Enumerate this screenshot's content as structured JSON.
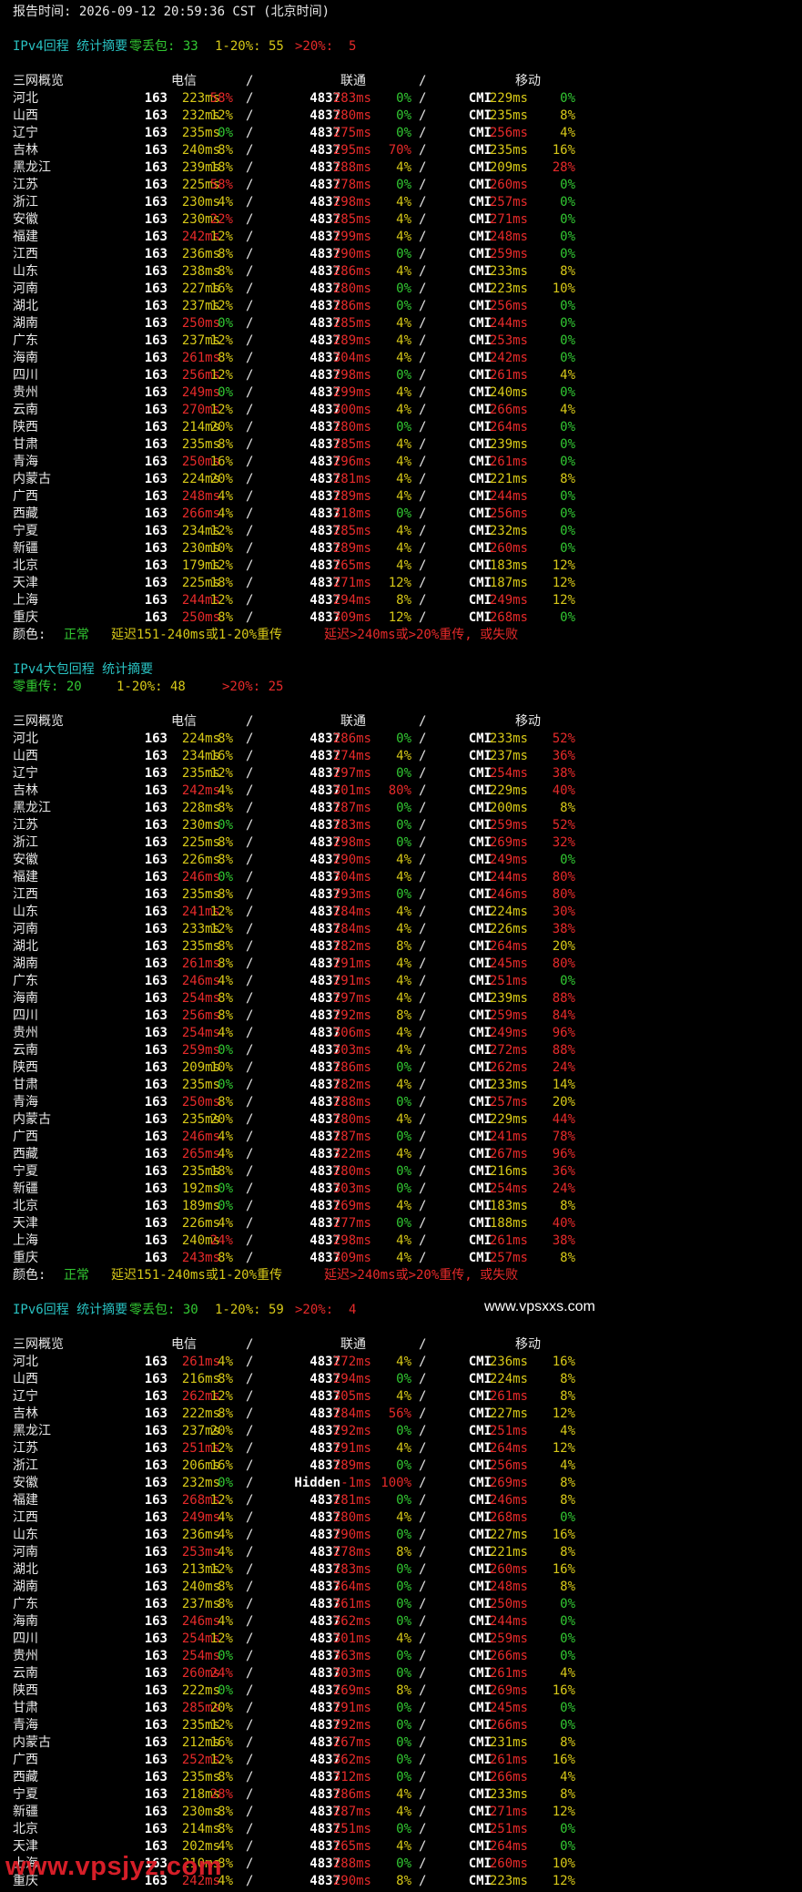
{
  "colors": {
    "normal": "#32c832",
    "mid": "#d7c818",
    "bad": "#e62a2a",
    "title": "#29c2c2"
  },
  "report_time": "报告时间: 2026-09-12 20:59:36 CST (北京时间)",
  "header": {
    "region": "三网概览",
    "telecom": "电信",
    "unicom": "联通",
    "mobile": "移动",
    "slash": "/"
  },
  "legend": {
    "label": "颜色: ",
    "normal": "正常",
    "mid": "延迟151-240ms或1-20%重传",
    "bad": "延迟>240ms或>20%重传, 或失败"
  },
  "watermark_mid": "www.vpsxxs.com",
  "watermark_bottom": "www.vpsjyz.com",
  "sections": [
    {
      "title": "IPv4回程 统计摘要",
      "summary": [
        {
          "text": "零丢包: 33",
          "c": "g"
        },
        {
          "text": "1-20%: 55",
          "c": "y"
        },
        {
          "text": ">20%:  5",
          "c": "rd"
        }
      ],
      "summary_on_next_line": false,
      "rows": [
        [
          "河北",
          "163",
          "223ms",
          "58%",
          "4837",
          "283ms",
          "0%",
          "CMI",
          "229ms",
          "0%"
        ],
        [
          "山西",
          "163",
          "232ms",
          "12%",
          "4837",
          "280ms",
          "0%",
          "CMI",
          "235ms",
          "8%"
        ],
        [
          "辽宁",
          "163",
          "235ms",
          "0%",
          "4837",
          "275ms",
          "0%",
          "CMI",
          "256ms",
          "4%"
        ],
        [
          "吉林",
          "163",
          "240ms",
          "8%",
          "4837",
          "295ms",
          "70%",
          "CMI",
          "235ms",
          "16%"
        ],
        [
          "黑龙江",
          "163",
          "239ms",
          "18%",
          "4837",
          "288ms",
          "4%",
          "CMI",
          "209ms",
          "28%"
        ],
        [
          "江苏",
          "163",
          "225ms",
          "58%",
          "4837",
          "278ms",
          "0%",
          "CMI",
          "260ms",
          "0%"
        ],
        [
          "浙江",
          "163",
          "230ms",
          "4%",
          "4837",
          "298ms",
          "4%",
          "CMI",
          "257ms",
          "0%"
        ],
        [
          "安徽",
          "163",
          "230ms",
          "22%",
          "4837",
          "285ms",
          "4%",
          "CMI",
          "271ms",
          "0%"
        ],
        [
          "福建",
          "163",
          "242ms",
          "12%",
          "4837",
          "299ms",
          "4%",
          "CMI",
          "248ms",
          "0%"
        ],
        [
          "江西",
          "163",
          "236ms",
          "8%",
          "4837",
          "290ms",
          "0%",
          "CMI",
          "259ms",
          "0%"
        ],
        [
          "山东",
          "163",
          "238ms",
          "8%",
          "4837",
          "286ms",
          "4%",
          "CMI",
          "233ms",
          "8%"
        ],
        [
          "河南",
          "163",
          "227ms",
          "16%",
          "4837",
          "280ms",
          "0%",
          "CMI",
          "223ms",
          "10%"
        ],
        [
          "湖北",
          "163",
          "237ms",
          "12%",
          "4837",
          "286ms",
          "0%",
          "CMI",
          "256ms",
          "0%"
        ],
        [
          "湖南",
          "163",
          "250ms",
          "0%",
          "4837",
          "285ms",
          "4%",
          "CMI",
          "244ms",
          "0%"
        ],
        [
          "广东",
          "163",
          "237ms",
          "12%",
          "4837",
          "289ms",
          "4%",
          "CMI",
          "253ms",
          "0%"
        ],
        [
          "海南",
          "163",
          "261ms",
          "8%",
          "4837",
          "304ms",
          "4%",
          "CMI",
          "242ms",
          "0%"
        ],
        [
          "四川",
          "163",
          "256ms",
          "12%",
          "4837",
          "298ms",
          "0%",
          "CMI",
          "261ms",
          "4%"
        ],
        [
          "贵州",
          "163",
          "249ms",
          "0%",
          "4837",
          "299ms",
          "4%",
          "CMI",
          "240ms",
          "0%"
        ],
        [
          "云南",
          "163",
          "270ms",
          "12%",
          "4837",
          "300ms",
          "4%",
          "CMI",
          "266ms",
          "4%"
        ],
        [
          "陕西",
          "163",
          "214ms",
          "20%",
          "4837",
          "280ms",
          "0%",
          "CMI",
          "264ms",
          "0%"
        ],
        [
          "甘肃",
          "163",
          "235ms",
          "8%",
          "4837",
          "285ms",
          "4%",
          "CMI",
          "239ms",
          "0%"
        ],
        [
          "青海",
          "163",
          "250ms",
          "16%",
          "4837",
          "296ms",
          "4%",
          "CMI",
          "261ms",
          "0%"
        ],
        [
          "内蒙古",
          "163",
          "224ms",
          "20%",
          "4837",
          "281ms",
          "4%",
          "CMI",
          "221ms",
          "8%"
        ],
        [
          "广西",
          "163",
          "248ms",
          "4%",
          "4837",
          "289ms",
          "4%",
          "CMI",
          "244ms",
          "0%"
        ],
        [
          "西藏",
          "163",
          "266ms",
          "4%",
          "4837",
          "318ms",
          "0%",
          "CMI",
          "256ms",
          "0%"
        ],
        [
          "宁夏",
          "163",
          "234ms",
          "12%",
          "4837",
          "285ms",
          "4%",
          "CMI",
          "232ms",
          "0%"
        ],
        [
          "新疆",
          "163",
          "230ms",
          "10%",
          "4837",
          "289ms",
          "4%",
          "CMI",
          "260ms",
          "0%"
        ],
        [
          "北京",
          "163",
          "179ms",
          "12%",
          "4837",
          "265ms",
          "4%",
          "CMI",
          "183ms",
          "12%"
        ],
        [
          "天津",
          "163",
          "225ms",
          "18%",
          "4837",
          "271ms",
          "12%",
          "CMI",
          "187ms",
          "12%"
        ],
        [
          "上海",
          "163",
          "244ms",
          "12%",
          "4837",
          "294ms",
          "8%",
          "CMI",
          "249ms",
          "12%"
        ],
        [
          "重庆",
          "163",
          "250ms",
          "8%",
          "4837",
          "309ms",
          "12%",
          "CMI",
          "268ms",
          "0%"
        ]
      ]
    },
    {
      "title": "IPv4大包回程 统计摘要",
      "summary": [
        {
          "text": "零重传: 20",
          "c": "g"
        },
        {
          "text": "1-20%: 48",
          "c": "y"
        },
        {
          "text": ">20%: 25",
          "c": "rd"
        }
      ],
      "summary_on_next_line": true,
      "rows": [
        [
          "河北",
          "163",
          "224ms",
          "8%",
          "4837",
          "286ms",
          "0%",
          "CMI",
          "233ms",
          "52%"
        ],
        [
          "山西",
          "163",
          "234ms",
          "16%",
          "4837",
          "274ms",
          "4%",
          "CMI",
          "237ms",
          "36%"
        ],
        [
          "辽宁",
          "163",
          "235ms",
          "12%",
          "4837",
          "297ms",
          "0%",
          "CMI",
          "254ms",
          "38%"
        ],
        [
          "吉林",
          "163",
          "242ms",
          "4%",
          "4837",
          "301ms",
          "80%",
          "CMI",
          "229ms",
          "40%"
        ],
        [
          "黑龙江",
          "163",
          "228ms",
          "8%",
          "4837",
          "287ms",
          "0%",
          "CMI",
          "200ms",
          "8%"
        ],
        [
          "江苏",
          "163",
          "230ms",
          "0%",
          "4837",
          "283ms",
          "0%",
          "CMI",
          "259ms",
          "52%"
        ],
        [
          "浙江",
          "163",
          "225ms",
          "8%",
          "4837",
          "298ms",
          "0%",
          "CMI",
          "269ms",
          "32%"
        ],
        [
          "安徽",
          "163",
          "226ms",
          "8%",
          "4837",
          "290ms",
          "4%",
          "CMI",
          "249ms",
          "0%"
        ],
        [
          "福建",
          "163",
          "246ms",
          "0%",
          "4837",
          "304ms",
          "4%",
          "CMI",
          "244ms",
          "80%"
        ],
        [
          "江西",
          "163",
          "235ms",
          "8%",
          "4837",
          "293ms",
          "0%",
          "CMI",
          "246ms",
          "80%"
        ],
        [
          "山东",
          "163",
          "241ms",
          "12%",
          "4837",
          "284ms",
          "4%",
          "CMI",
          "224ms",
          "30%"
        ],
        [
          "河南",
          "163",
          "233ms",
          "12%",
          "4837",
          "284ms",
          "4%",
          "CMI",
          "226ms",
          "38%"
        ],
        [
          "湖北",
          "163",
          "235ms",
          "8%",
          "4837",
          "282ms",
          "8%",
          "CMI",
          "264ms",
          "20%"
        ],
        [
          "湖南",
          "163",
          "261ms",
          "8%",
          "4837",
          "291ms",
          "4%",
          "CMI",
          "245ms",
          "80%"
        ],
        [
          "广东",
          "163",
          "246ms",
          "4%",
          "4837",
          "291ms",
          "4%",
          "CMI",
          "251ms",
          "0%"
        ],
        [
          "海南",
          "163",
          "254ms",
          "8%",
          "4837",
          "297ms",
          "4%",
          "CMI",
          "239ms",
          "88%"
        ],
        [
          "四川",
          "163",
          "256ms",
          "8%",
          "4837",
          "292ms",
          "8%",
          "CMI",
          "259ms",
          "84%"
        ],
        [
          "贵州",
          "163",
          "254ms",
          "4%",
          "4837",
          "306ms",
          "4%",
          "CMI",
          "249ms",
          "96%"
        ],
        [
          "云南",
          "163",
          "259ms",
          "0%",
          "4837",
          "303ms",
          "4%",
          "CMI",
          "272ms",
          "88%"
        ],
        [
          "陕西",
          "163",
          "209ms",
          "10%",
          "4837",
          "286ms",
          "0%",
          "CMI",
          "262ms",
          "24%"
        ],
        [
          "甘肃",
          "163",
          "235ms",
          "0%",
          "4837",
          "282ms",
          "4%",
          "CMI",
          "233ms",
          "14%"
        ],
        [
          "青海",
          "163",
          "250ms",
          "8%",
          "4837",
          "288ms",
          "0%",
          "CMI",
          "257ms",
          "20%"
        ],
        [
          "内蒙古",
          "163",
          "235ms",
          "20%",
          "4837",
          "280ms",
          "4%",
          "CMI",
          "229ms",
          "44%"
        ],
        [
          "广西",
          "163",
          "246ms",
          "4%",
          "4837",
          "287ms",
          "0%",
          "CMI",
          "241ms",
          "78%"
        ],
        [
          "西藏",
          "163",
          "265ms",
          "4%",
          "4837",
          "322ms",
          "4%",
          "CMI",
          "267ms",
          "96%"
        ],
        [
          "宁夏",
          "163",
          "235ms",
          "18%",
          "4837",
          "280ms",
          "0%",
          "CMI",
          "216ms",
          "36%"
        ],
        [
          "新疆",
          "163",
          "192ms",
          "0%",
          "4837",
          "303ms",
          "0%",
          "CMI",
          "254ms",
          "24%"
        ],
        [
          "北京",
          "163",
          "189ms",
          "0%",
          "4837",
          "269ms",
          "4%",
          "CMI",
          "183ms",
          "8%"
        ],
        [
          "天津",
          "163",
          "226ms",
          "4%",
          "4837",
          "277ms",
          "0%",
          "CMI",
          "188ms",
          "40%"
        ],
        [
          "上海",
          "163",
          "240ms",
          "24%",
          "4837",
          "298ms",
          "4%",
          "CMI",
          "261ms",
          "38%"
        ],
        [
          "重庆",
          "163",
          "243ms",
          "8%",
          "4837",
          "309ms",
          "4%",
          "CMI",
          "257ms",
          "8%"
        ]
      ]
    },
    {
      "title": "IPv6回程 统计摘要",
      "summary": [
        {
          "text": "零丢包: 30",
          "c": "g"
        },
        {
          "text": "1-20%: 59",
          "c": "y"
        },
        {
          "text": ">20%:  4",
          "c": "rd"
        }
      ],
      "summary_on_next_line": false,
      "rows": [
        [
          "河北",
          "163",
          "261ms",
          "4%",
          "4837",
          "272ms",
          "4%",
          "CMI",
          "236ms",
          "16%"
        ],
        [
          "山西",
          "163",
          "216ms",
          "8%",
          "4837",
          "294ms",
          "0%",
          "CMI",
          "224ms",
          "8%"
        ],
        [
          "辽宁",
          "163",
          "262ms",
          "12%",
          "4837",
          "305ms",
          "4%",
          "CMI",
          "261ms",
          "8%"
        ],
        [
          "吉林",
          "163",
          "222ms",
          "8%",
          "4837",
          "284ms",
          "56%",
          "CMI",
          "227ms",
          "12%"
        ],
        [
          "黑龙江",
          "163",
          "237ms",
          "20%",
          "4837",
          "292ms",
          "0%",
          "CMI",
          "251ms",
          "4%"
        ],
        [
          "江苏",
          "163",
          "251ms",
          "12%",
          "4837",
          "291ms",
          "4%",
          "CMI",
          "264ms",
          "12%"
        ],
        [
          "浙江",
          "163",
          "206ms",
          "16%",
          "4837",
          "289ms",
          "0%",
          "CMI",
          "256ms",
          "4%"
        ],
        [
          "安徽",
          "163",
          "232ms",
          "0%",
          "Hidden",
          "-1ms",
          "100%",
          "CMI",
          "269ms",
          "8%"
        ],
        [
          "福建",
          "163",
          "268ms",
          "12%",
          "4837",
          "281ms",
          "0%",
          "CMI",
          "246ms",
          "8%"
        ],
        [
          "江西",
          "163",
          "249ms",
          "4%",
          "4837",
          "280ms",
          "4%",
          "CMI",
          "268ms",
          "0%"
        ],
        [
          "山东",
          "163",
          "236ms",
          "4%",
          "4837",
          "290ms",
          "0%",
          "CMI",
          "227ms",
          "16%"
        ],
        [
          "河南",
          "163",
          "253ms",
          "4%",
          "4837",
          "278ms",
          "8%",
          "CMI",
          "221ms",
          "8%"
        ],
        [
          "湖北",
          "163",
          "213ms",
          "12%",
          "4837",
          "283ms",
          "0%",
          "CMI",
          "260ms",
          "16%"
        ],
        [
          "湖南",
          "163",
          "240ms",
          "8%",
          "4837",
          "364ms",
          "0%",
          "CMI",
          "248ms",
          "8%"
        ],
        [
          "广东",
          "163",
          "237ms",
          "8%",
          "4837",
          "361ms",
          "0%",
          "CMI",
          "250ms",
          "0%"
        ],
        [
          "海南",
          "163",
          "246ms",
          "4%",
          "4837",
          "362ms",
          "0%",
          "CMI",
          "244ms",
          "0%"
        ],
        [
          "四川",
          "163",
          "254ms",
          "12%",
          "4837",
          "301ms",
          "4%",
          "CMI",
          "259ms",
          "0%"
        ],
        [
          "贵州",
          "163",
          "254ms",
          "0%",
          "4837",
          "363ms",
          "0%",
          "CMI",
          "266ms",
          "0%"
        ],
        [
          "云南",
          "163",
          "260ms",
          "24%",
          "4837",
          "303ms",
          "0%",
          "CMI",
          "261ms",
          "4%"
        ],
        [
          "陕西",
          "163",
          "222ms",
          "0%",
          "4837",
          "269ms",
          "8%",
          "CMI",
          "269ms",
          "16%"
        ],
        [
          "甘肃",
          "163",
          "285ms",
          "20%",
          "4837",
          "291ms",
          "0%",
          "CMI",
          "245ms",
          "0%"
        ],
        [
          "青海",
          "163",
          "235ms",
          "12%",
          "4837",
          "292ms",
          "0%",
          "CMI",
          "266ms",
          "0%"
        ],
        [
          "内蒙古",
          "163",
          "212ms",
          "16%",
          "4837",
          "267ms",
          "0%",
          "CMI",
          "231ms",
          "8%"
        ],
        [
          "广西",
          "163",
          "252ms",
          "12%",
          "4837",
          "362ms",
          "0%",
          "CMI",
          "261ms",
          "16%"
        ],
        [
          "西藏",
          "163",
          "235ms",
          "8%",
          "4837",
          "312ms",
          "0%",
          "CMI",
          "266ms",
          "4%"
        ],
        [
          "宁夏",
          "163",
          "218ms",
          "28%",
          "4837",
          "286ms",
          "4%",
          "CMI",
          "233ms",
          "8%"
        ],
        [
          "新疆",
          "163",
          "230ms",
          "8%",
          "4837",
          "287ms",
          "4%",
          "CMI",
          "271ms",
          "12%"
        ],
        [
          "北京",
          "163",
          "214ms",
          "8%",
          "4837",
          "251ms",
          "0%",
          "CMI",
          "251ms",
          "0%"
        ],
        [
          "天津",
          "163",
          "202ms",
          "4%",
          "4837",
          "265ms",
          "4%",
          "CMI",
          "264ms",
          "0%"
        ],
        [
          "上海",
          "163",
          "210ms",
          "8%",
          "4837",
          "288ms",
          "0%",
          "CMI",
          "260ms",
          "10%"
        ],
        [
          "重庆",
          "163",
          "242ms",
          "4%",
          "4837",
          "290ms",
          "8%",
          "CMI",
          "223ms",
          "12%"
        ]
      ]
    }
  ]
}
